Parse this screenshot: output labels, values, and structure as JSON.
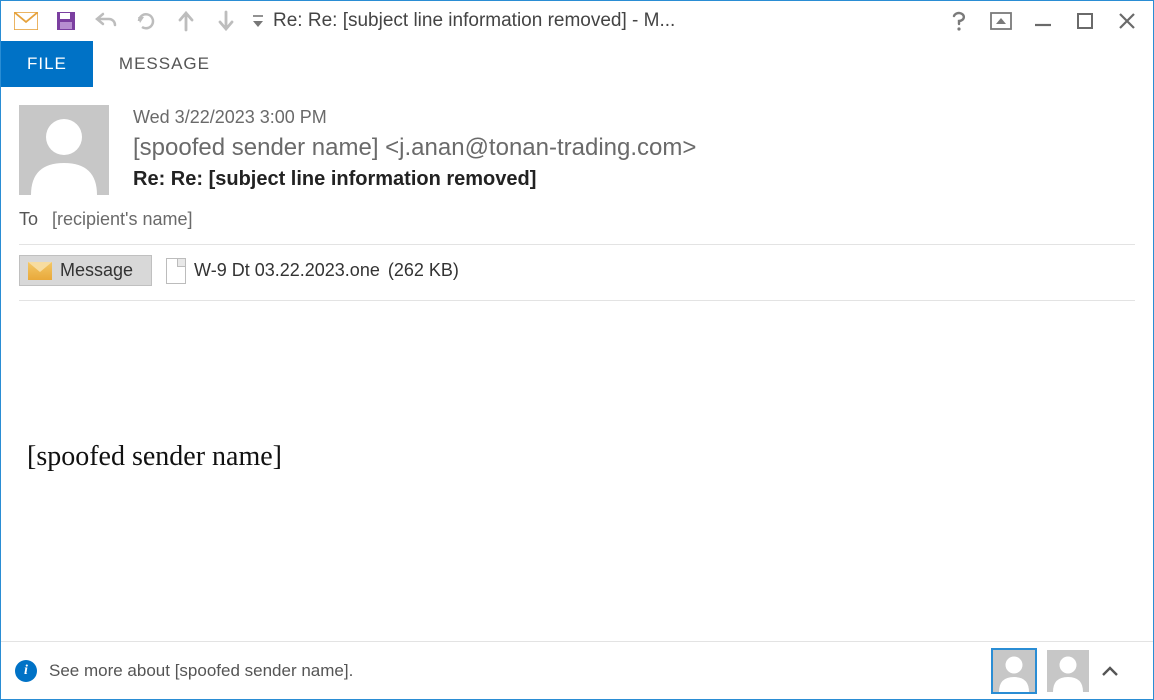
{
  "window_title": "Re: Re: [subject line information removed] - M...",
  "tabs": {
    "file": "FILE",
    "message": "MESSAGE"
  },
  "header": {
    "date": "Wed 3/22/2023 3:00 PM",
    "from": "[spoofed sender name] <j.anan@tonan-trading.com>",
    "subject": "Re: Re: [subject line information removed]"
  },
  "to": {
    "label": "To",
    "value": "[recipient's name]"
  },
  "message_tab_label": "Message",
  "attachment": {
    "name": "W-9 Dt 03.22.2023.one",
    "size": "(262 KB)"
  },
  "body_signature": "[spoofed sender name]",
  "footer": {
    "text": "See more about [spoofed sender name]."
  },
  "icons": {
    "mail": "mail-icon",
    "save": "save-icon",
    "undo": "undo-icon",
    "refresh": "refresh-icon",
    "prev": "arrow-up-icon",
    "next": "arrow-down-icon",
    "customize": "customize-qat-icon",
    "help": "help-icon",
    "popout": "popout-icon",
    "minimize": "minimize-icon",
    "maximize": "maximize-icon",
    "close": "close-icon",
    "info": "info-icon",
    "expand": "chevron-up-icon"
  }
}
